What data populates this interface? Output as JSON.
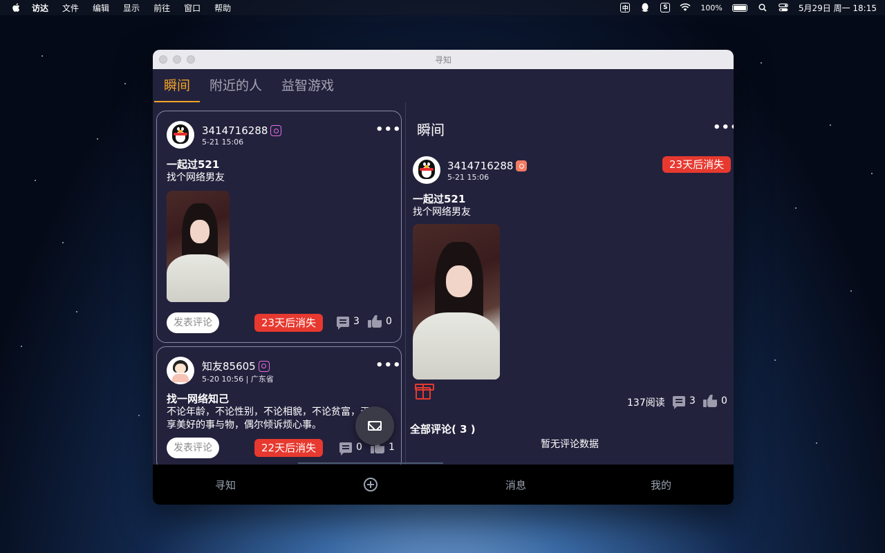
{
  "menubar": {
    "app_name": "访达",
    "menus": [
      "文件",
      "编辑",
      "显示",
      "前往",
      "窗口",
      "帮助"
    ],
    "input_method": "中",
    "battery": "100%",
    "datetime": "5月29日 周一  18:15"
  },
  "window": {
    "title": "寻知"
  },
  "tabs": [
    {
      "label": "瞬间"
    },
    {
      "label": "附近的人"
    },
    {
      "label": "益智游戏"
    }
  ],
  "feed": [
    {
      "username": "3414716288",
      "meta": "5-21 15:06",
      "title": "一起过521",
      "body": "找个网络男友",
      "comment_button": "发表评论",
      "expire": "23天后消失",
      "comments": "3",
      "likes": "0"
    },
    {
      "username": "知友85605",
      "meta": "5-20 10:56 | 广东省",
      "title": "找一网络知己",
      "body": "不论年龄，不论性别，不论相貌，不论贫富，天分享美好的事与物，偶尔倾诉烦心事。",
      "comment_button": "发表评论",
      "expire": "22天后消失",
      "comments": "0",
      "likes": "1"
    }
  ],
  "detail": {
    "header": "瞬间",
    "username": "3414716288",
    "meta": "5-21 15:06",
    "expire": "23天后消失",
    "title": "一起过521",
    "body": "找个网络男友",
    "reads": "137阅读",
    "comments": "3",
    "likes": "0",
    "comments_title": "全部评论( 3 )",
    "no_comments": "暂无评论数据"
  },
  "bottom_nav": {
    "home": "寻知",
    "messages": "消息",
    "mine": "我的"
  },
  "colors": {
    "accent": "#f5a524",
    "expire_red": "#e7392f",
    "window_bg": "#23223d"
  }
}
